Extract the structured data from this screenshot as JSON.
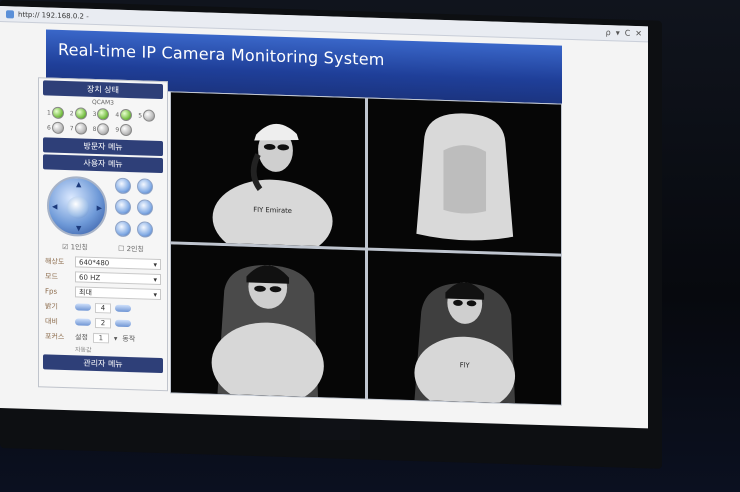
{
  "browser": {
    "url": "http:// 192.168.0.2 -",
    "controls": [
      "ρ",
      "▾",
      "C",
      "✕"
    ]
  },
  "app": {
    "title": "Real-time IP Camera Monitoring System"
  },
  "sidebar": {
    "device_status": "장치 상태",
    "camera_group": "QCAM3",
    "cameras": [
      {
        "num": "1",
        "state": "on"
      },
      {
        "num": "2",
        "state": "on"
      },
      {
        "num": "3",
        "state": "on"
      },
      {
        "num": "4",
        "state": "on"
      },
      {
        "num": "5",
        "state": "off"
      },
      {
        "num": "6",
        "state": "off"
      },
      {
        "num": "7",
        "state": "off"
      },
      {
        "num": "8",
        "state": "off"
      },
      {
        "num": "9",
        "state": "off"
      }
    ],
    "visitor_menu": "방문자 메뉴",
    "user_menu": "사용자 메뉴",
    "radio_a": "1인칭",
    "radio_b": "2인칭",
    "resolution_label": "해상도",
    "resolution_value": "640*480",
    "mode_label": "모드",
    "mode_value": "60 HZ",
    "fps_label": "Fps",
    "fps_value": "최대",
    "brightness_label": "밝기",
    "brightness_value": "4",
    "contrast_label": "대비",
    "contrast_value": "2",
    "focus_label": "포커스",
    "focus_set": "설정",
    "focus_value": "1",
    "focus_action": "동작",
    "focus_sub": "자동값",
    "admin_menu": "관리자 메뉴"
  },
  "feeds": [
    {
      "name": "camera-feed-1",
      "shirt_text": "FIY Emirate"
    },
    {
      "name": "camera-feed-2"
    },
    {
      "name": "camera-feed-3"
    },
    {
      "name": "camera-feed-4",
      "shirt_text": "FlY"
    }
  ]
}
